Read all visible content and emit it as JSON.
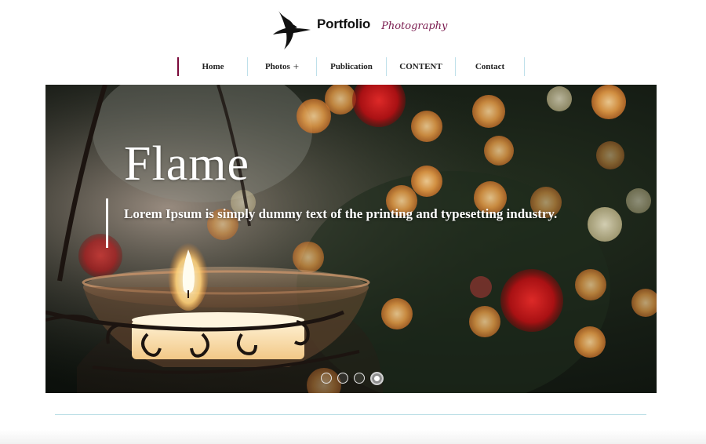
{
  "brand": {
    "title": "Portfolio",
    "subtitle": "Photography",
    "logo_icon": "swallow-bird-icon"
  },
  "nav": {
    "items": [
      {
        "label": "Home",
        "active": true
      },
      {
        "label": "Photos",
        "has_submenu": true,
        "submenu_indicator": "+"
      },
      {
        "label": "Publication"
      },
      {
        "label": "CONTENT"
      },
      {
        "label": "Contact"
      }
    ]
  },
  "slider": {
    "caption_title": "Flame",
    "caption_text": "Lorem Ipsum is simply dummy text of the printing and typesetting industry.",
    "slide_count": 4,
    "active_slide": 4,
    "image_subject": "candle-in-glass-holder-bokeh-lights"
  },
  "colors": {
    "accent": "#7a0a3a",
    "subtitle": "#7a1a4e",
    "nav_separator": "#bfe0ea",
    "divider": "#bcdfe6"
  }
}
